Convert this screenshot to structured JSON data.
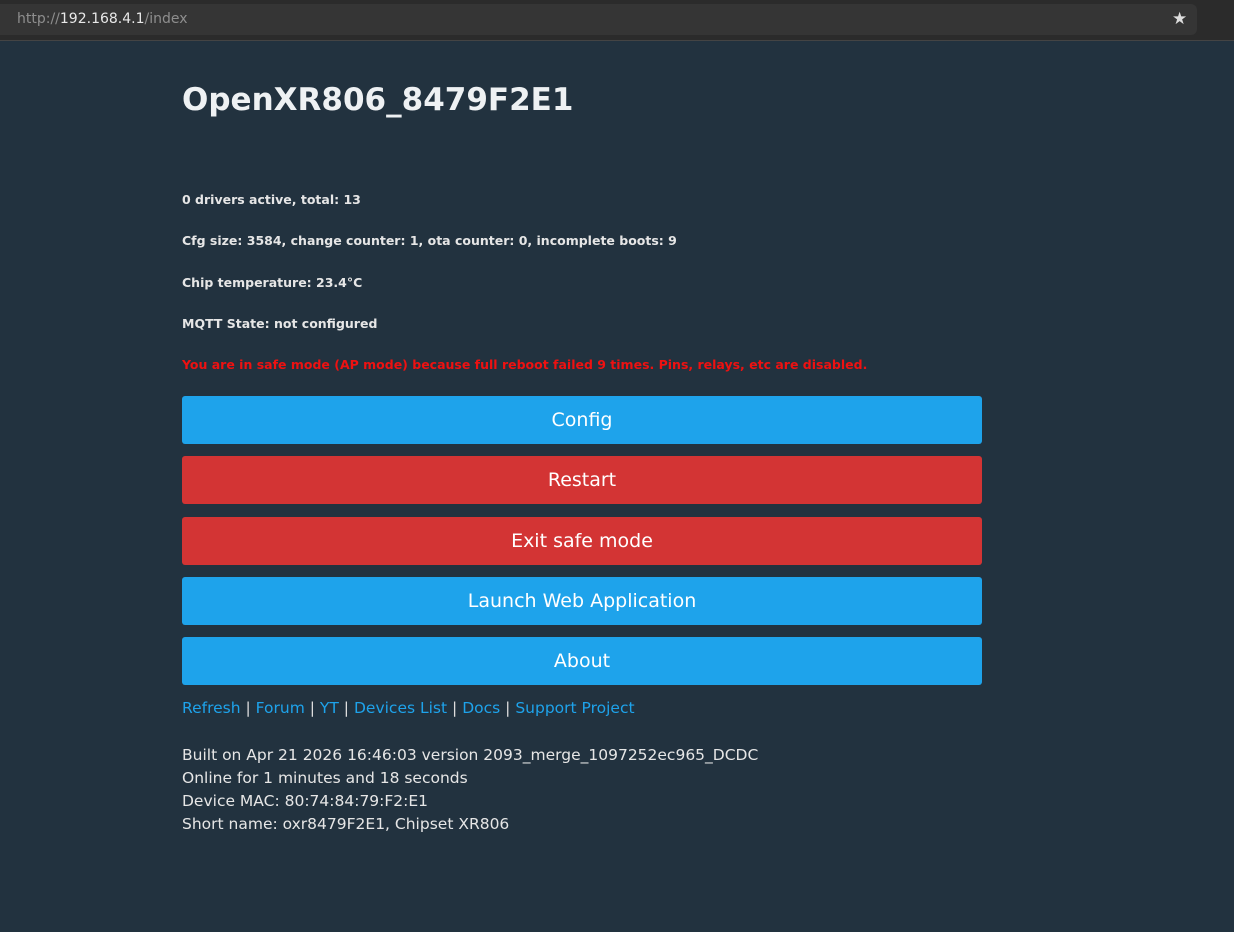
{
  "browser": {
    "url_scheme": "http://",
    "url_host": "192.168.4.1",
    "url_path": "/index",
    "star_icon": "★"
  },
  "title": "OpenXR806_8479F2E1",
  "info": [
    "0 drivers active, total: 13",
    "Cfg size: 3584, change counter: 1, ota counter: 0, incomplete boots: 9",
    "Chip temperature: 23.4°C",
    "MQTT State: not configured"
  ],
  "warning": "You are in safe mode (AP mode) because full reboot failed 9 times. Pins, relays, etc are disabled.",
  "buttons": [
    "Config",
    "Restart",
    "Exit safe mode",
    "Launch Web Application",
    "About"
  ],
  "links": [
    "Refresh",
    "Forum",
    "YT",
    "Devices List",
    "Docs",
    "Support Project"
  ],
  "separator": "|",
  "footer": [
    "Built on Apr 21 2026 16:46:03 version 2093_merge_1097252ec965_DCDC",
    "Online for 1 minutes and 18 seconds",
    "Device MAC: 80:74:84:79:F2:E1",
    "Short name: oxr8479F2E1, Chipset XR806"
  ],
  "colors": {
    "blue": "#1ea3eb",
    "red": "#d33434",
    "warning": "#ee1111",
    "background": "#22323f"
  }
}
